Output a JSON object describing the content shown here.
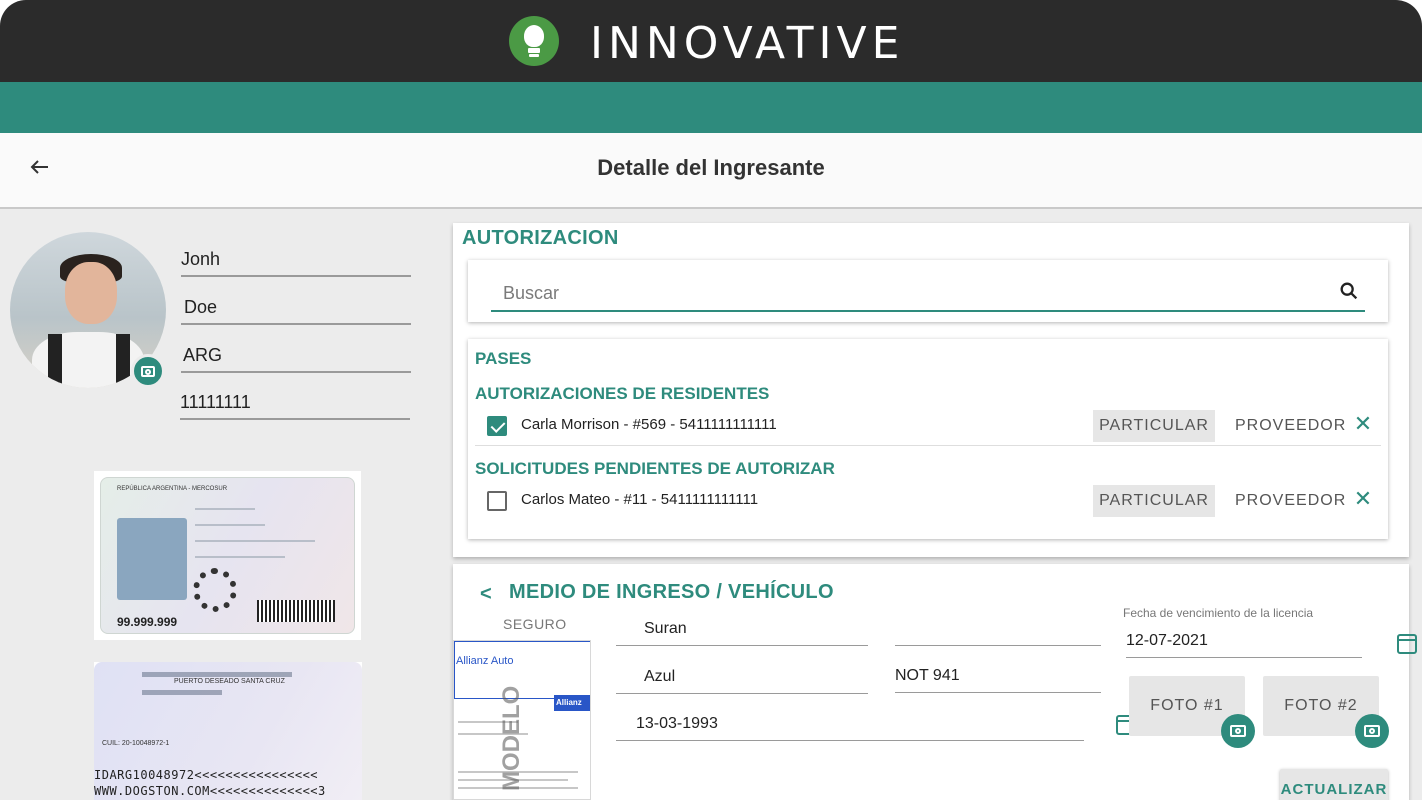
{
  "brand": {
    "name": "INNOVATIVE"
  },
  "header": {
    "title": "Detalle del Ingresante"
  },
  "profile": {
    "first_name": "Jonh",
    "last_name": "Doe",
    "country": "ARG",
    "document_number": "11111111"
  },
  "id_front": {
    "number": "99.999.999",
    "header": "REPÚBLICA ARGENTINA - MERCOSUR"
  },
  "id_back": {
    "place": "PUERTO DESEADO SANTA CRUZ",
    "cuil": "CUIL: 20-10048972-1",
    "mrz1": "IDARG10048972<<<<<<<<<<<<<<<<",
    "mrz2": "WWW.DOGSTON.COM<<<<<<<<<<<<<<3"
  },
  "authorization": {
    "title": "AUTORIZACION",
    "search_placeholder": "Buscar",
    "passes_title": "PASES",
    "residents_title": "AUTORIZACIONES DE RESIDENTES",
    "pending_title": "SOLICITUDES PENDIENTES DE AUTORIZAR",
    "residents": [
      {
        "text": "Carla Morrison - #569 - 5411111111111",
        "checked": true,
        "particular": "PARTICULAR",
        "proveedor": "PROVEEDOR"
      }
    ],
    "pending": [
      {
        "text": "Carlos  Mateo - #11 - 5411111111111",
        "checked": false,
        "particular": "PARTICULAR",
        "proveedor": "PROVEEDOR"
      }
    ]
  },
  "vehicle": {
    "title": "MEDIO DE INGRESO / VEHÍCULO",
    "seguro_label": "SEGURO",
    "insurance": {
      "brand": "Allianz Auto",
      "badge": "Allianz",
      "watermark": "MODELO"
    },
    "brand_value": "Suran",
    "field_empty": "",
    "color_value": "Azul",
    "plate_value": "NOT 941",
    "date_value": "13-03-1993",
    "license_label": "Fecha de vencimiento de la licencia",
    "license_date": "12-07-2021",
    "photo1": "FOTO #1",
    "photo2": "FOTO #2",
    "update_button": "ACTUALIZAR"
  }
}
